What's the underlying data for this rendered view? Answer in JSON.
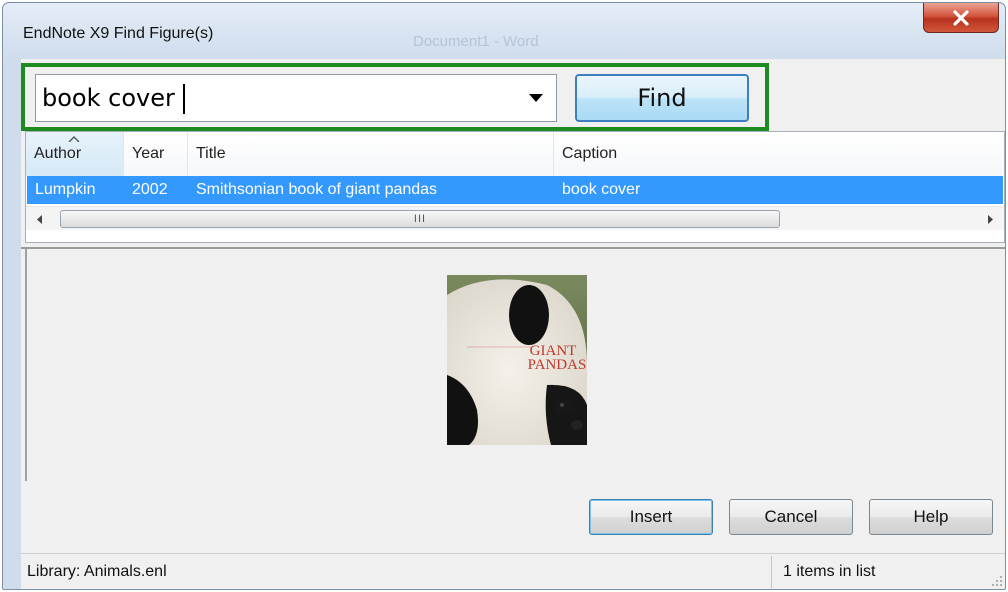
{
  "window": {
    "title": "EndNote X9 Find Figure(s)",
    "background_title": "Document1 - Word",
    "accent_color": "#3399ff",
    "highlight_color": "#1f8a1f"
  },
  "search": {
    "value": "book cover",
    "dropdown_icon": "triangle-down-icon",
    "find_label": "Find"
  },
  "results": {
    "columns": [
      {
        "label": "Author",
        "sorted": "ascending"
      },
      {
        "label": "Year"
      },
      {
        "label": "Title"
      },
      {
        "label": "Caption"
      }
    ],
    "rows": [
      {
        "author": "Lumpkin",
        "year": "2002",
        "title": "Smithsonian book of giant pandas",
        "caption": "book cover",
        "selected": true
      }
    ],
    "scroll_grip": "III"
  },
  "preview": {
    "cover_title_line1": "GIANT",
    "cover_title_line2": "PANDAS"
  },
  "buttons": {
    "insert": "Insert",
    "cancel": "Cancel",
    "help": "Help"
  },
  "status": {
    "library": "Library: Animals.enl",
    "count": "1 items in list"
  }
}
